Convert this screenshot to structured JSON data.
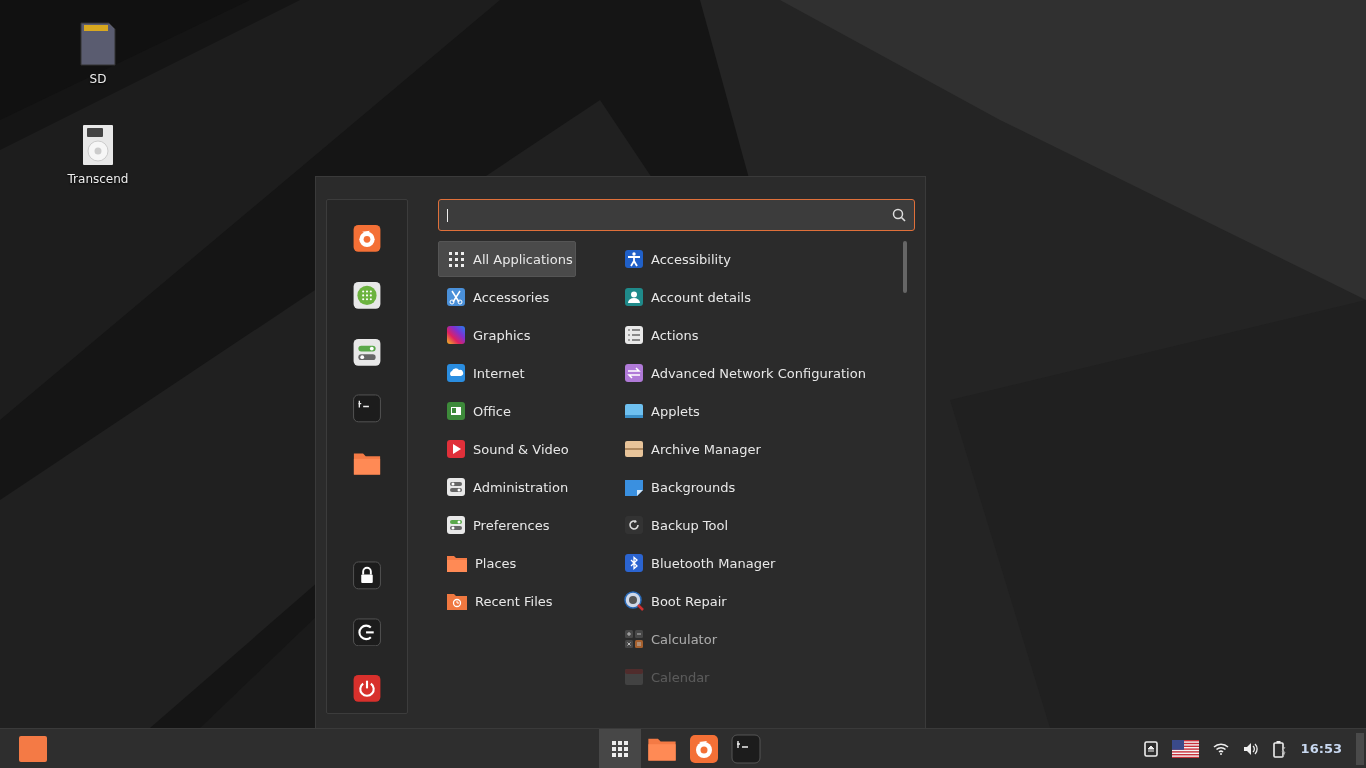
{
  "desktop_icons": [
    {
      "label": "SD"
    },
    {
      "label": "Transcend"
    }
  ],
  "menu": {
    "categories": [
      {
        "label": "All Applications",
        "selected": true
      },
      {
        "label": "Accessories",
        "selected": false
      },
      {
        "label": "Graphics",
        "selected": false
      },
      {
        "label": "Internet",
        "selected": false
      },
      {
        "label": "Office",
        "selected": false
      },
      {
        "label": "Sound & Video",
        "selected": false
      },
      {
        "label": "Administration",
        "selected": false
      },
      {
        "label": "Preferences",
        "selected": false
      },
      {
        "label": "Places",
        "selected": false
      },
      {
        "label": "Recent Files",
        "selected": false
      }
    ],
    "applications": [
      {
        "label": "Accessibility"
      },
      {
        "label": "Account details"
      },
      {
        "label": "Actions"
      },
      {
        "label": "Advanced Network Configuration"
      },
      {
        "label": "Applets"
      },
      {
        "label": "Archive Manager"
      },
      {
        "label": "Backgrounds"
      },
      {
        "label": "Backup Tool"
      },
      {
        "label": "Bluetooth Manager"
      },
      {
        "label": "Boot Repair"
      },
      {
        "label": "Calculator"
      },
      {
        "label": "Calendar"
      }
    ]
  },
  "taskbar": {
    "launchers": [
      {
        "selected": true
      },
      {
        "selected": false
      },
      {
        "selected": false
      },
      {
        "selected": false
      }
    ],
    "clock": "16:53"
  }
}
